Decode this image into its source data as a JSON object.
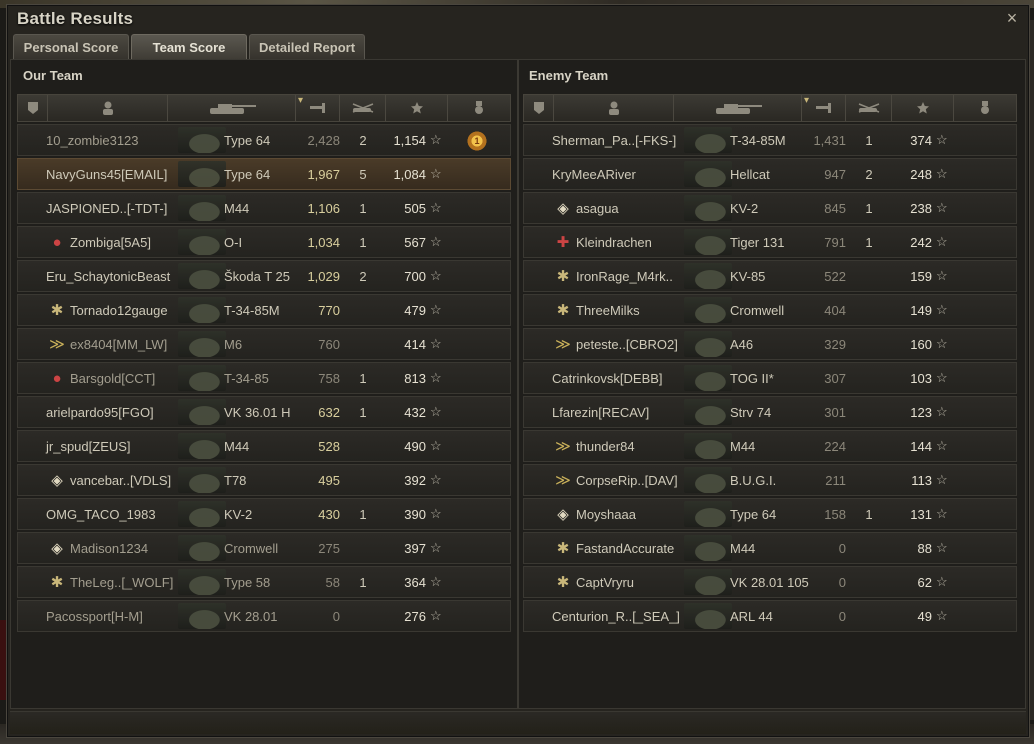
{
  "window": {
    "title": "Battle Results",
    "close_icon": "×"
  },
  "tabs": [
    {
      "label": "Personal Score"
    },
    {
      "label": "Team Score"
    },
    {
      "label": "Detailed Report"
    }
  ],
  "our_team": {
    "title": "Our Team",
    "rows": [
      {
        "player": "10_zombie3123",
        "vehicle": "Type 64",
        "xp": "2,428",
        "kills": "2",
        "score": "1,154",
        "medal": "1"
      },
      {
        "player": "NavyGuns45[EMAIL]",
        "vehicle": "Type 64",
        "xp": "1,967",
        "kills": "5",
        "score": "1,084",
        "medal": ""
      },
      {
        "player": "JASPIONED..[-TDT-]",
        "vehicle": "M44",
        "xp": "1,106",
        "kills": "1",
        "score": "505",
        "medal": ""
      },
      {
        "player": "Zombiga[5A5]",
        "vehicle": "O-I",
        "xp": "1,034",
        "kills": "1",
        "score": "567",
        "medal": ""
      },
      {
        "player": "Eru_SchaytonicBeast",
        "vehicle": "Škoda T 25",
        "xp": "1,029",
        "kills": "2",
        "score": "700",
        "medal": ""
      },
      {
        "player": "Tornado12gauge",
        "vehicle": "T-34-85M",
        "xp": "770",
        "kills": "",
        "score": "479",
        "medal": ""
      },
      {
        "player": "ex8404[MM_LW]",
        "vehicle": "M6",
        "xp": "760",
        "kills": "",
        "score": "414",
        "medal": ""
      },
      {
        "player": "Barsgold[CCT]",
        "vehicle": "T-34-85",
        "xp": "758",
        "kills": "1",
        "score": "813",
        "medal": ""
      },
      {
        "player": "arielpardo95[FGO]",
        "vehicle": "VK 36.01 H",
        "xp": "632",
        "kills": "1",
        "score": "432",
        "medal": ""
      },
      {
        "player": "jr_spud[ZEUS]",
        "vehicle": "M44",
        "xp": "528",
        "kills": "",
        "score": "490",
        "medal": ""
      },
      {
        "player": "vancebar..[VDLS]",
        "vehicle": "T78",
        "xp": "495",
        "kills": "",
        "score": "392",
        "medal": ""
      },
      {
        "player": "OMG_TACO_1983",
        "vehicle": "KV-2",
        "xp": "430",
        "kills": "1",
        "score": "390",
        "medal": ""
      },
      {
        "player": "Madison1234",
        "vehicle": "Cromwell",
        "xp": "275",
        "kills": "",
        "score": "397",
        "medal": ""
      },
      {
        "player": "TheLeg..[_WOLF]",
        "vehicle": "Type 58",
        "xp": "58",
        "kills": "1",
        "score": "364",
        "medal": ""
      },
      {
        "player": "Pacossport[H-M]",
        "vehicle": "VK 28.01",
        "xp": "0",
        "kills": "",
        "score": "276",
        "medal": ""
      }
    ]
  },
  "enemy_team": {
    "title": "Enemy Team",
    "rows": [
      {
        "player": "Sherman_Pa..[-FKS-]",
        "vehicle": "T-34-85M",
        "xp": "1,431",
        "kills": "1",
        "score": "374"
      },
      {
        "player": "KryMeeARiver",
        "vehicle": "Hellcat",
        "xp": "947",
        "kills": "2",
        "score": "248"
      },
      {
        "player": "asagua",
        "vehicle": "KV-2",
        "xp": "845",
        "kills": "1",
        "score": "238"
      },
      {
        "player": "Kleindrachen",
        "vehicle": "Tiger 131",
        "xp": "791",
        "kills": "1",
        "score": "242"
      },
      {
        "player": "IronRage_M4rk..",
        "vehicle": "KV-85",
        "xp": "522",
        "kills": "",
        "score": "159"
      },
      {
        "player": "ThreeMilks",
        "vehicle": "Cromwell",
        "xp": "404",
        "kills": "",
        "score": "149"
      },
      {
        "player": "peteste..[CBRO2]",
        "vehicle": "A46",
        "xp": "329",
        "kills": "",
        "score": "160"
      },
      {
        "player": "Catrinkovsk[DEBB]",
        "vehicle": "TOG II*",
        "xp": "307",
        "kills": "",
        "score": "103"
      },
      {
        "player": "Lfarezin[RECAV]",
        "vehicle": "Strv 74",
        "xp": "301",
        "kills": "",
        "score": "123"
      },
      {
        "player": "thunder84",
        "vehicle": "M44",
        "xp": "224",
        "kills": "",
        "score": "144"
      },
      {
        "player": "CorpseRip..[DAV]",
        "vehicle": "B.U.G.I.",
        "xp": "211",
        "kills": "",
        "score": "113"
      },
      {
        "player": "Moyshaaa",
        "vehicle": "Type 64",
        "xp": "158",
        "kills": "1",
        "score": "131"
      },
      {
        "player": "FastandAccurate",
        "vehicle": "M44",
        "xp": "0",
        "kills": "",
        "score": "88"
      },
      {
        "player": "CaptVryru",
        "vehicle": "VK 28.01 105",
        "xp": "0",
        "kills": "",
        "score": "62"
      },
      {
        "player": "Centurion_R..[_SEA_]",
        "vehicle": "ARL 44",
        "xp": "0",
        "kills": "",
        "score": "49"
      }
    ]
  },
  "icons": {
    "star": "☆",
    "sort_arrow": "▾"
  },
  "colors": {
    "highlight_row": "#4a3b28",
    "xp_gold": "#d9cf9e"
  }
}
